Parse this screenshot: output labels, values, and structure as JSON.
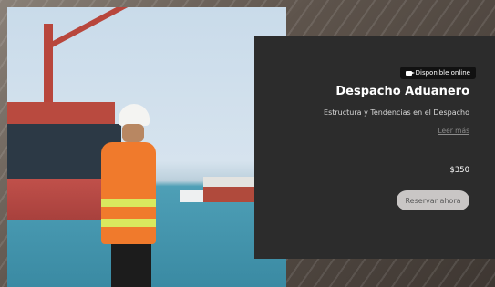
{
  "card": {
    "badge": "Disponible online",
    "badge_icon": "video-camera-icon",
    "title": "Despacho Aduanero",
    "subtitle": "Estructura y Tendencias en el Despacho",
    "read_more": "Leer más",
    "price": "$350",
    "reserve_label": "Reservar ahora"
  },
  "colors": {
    "card_bg": "#2c2c2c",
    "button_bg": "#c9c6c5",
    "vest": "#f07a2c"
  }
}
